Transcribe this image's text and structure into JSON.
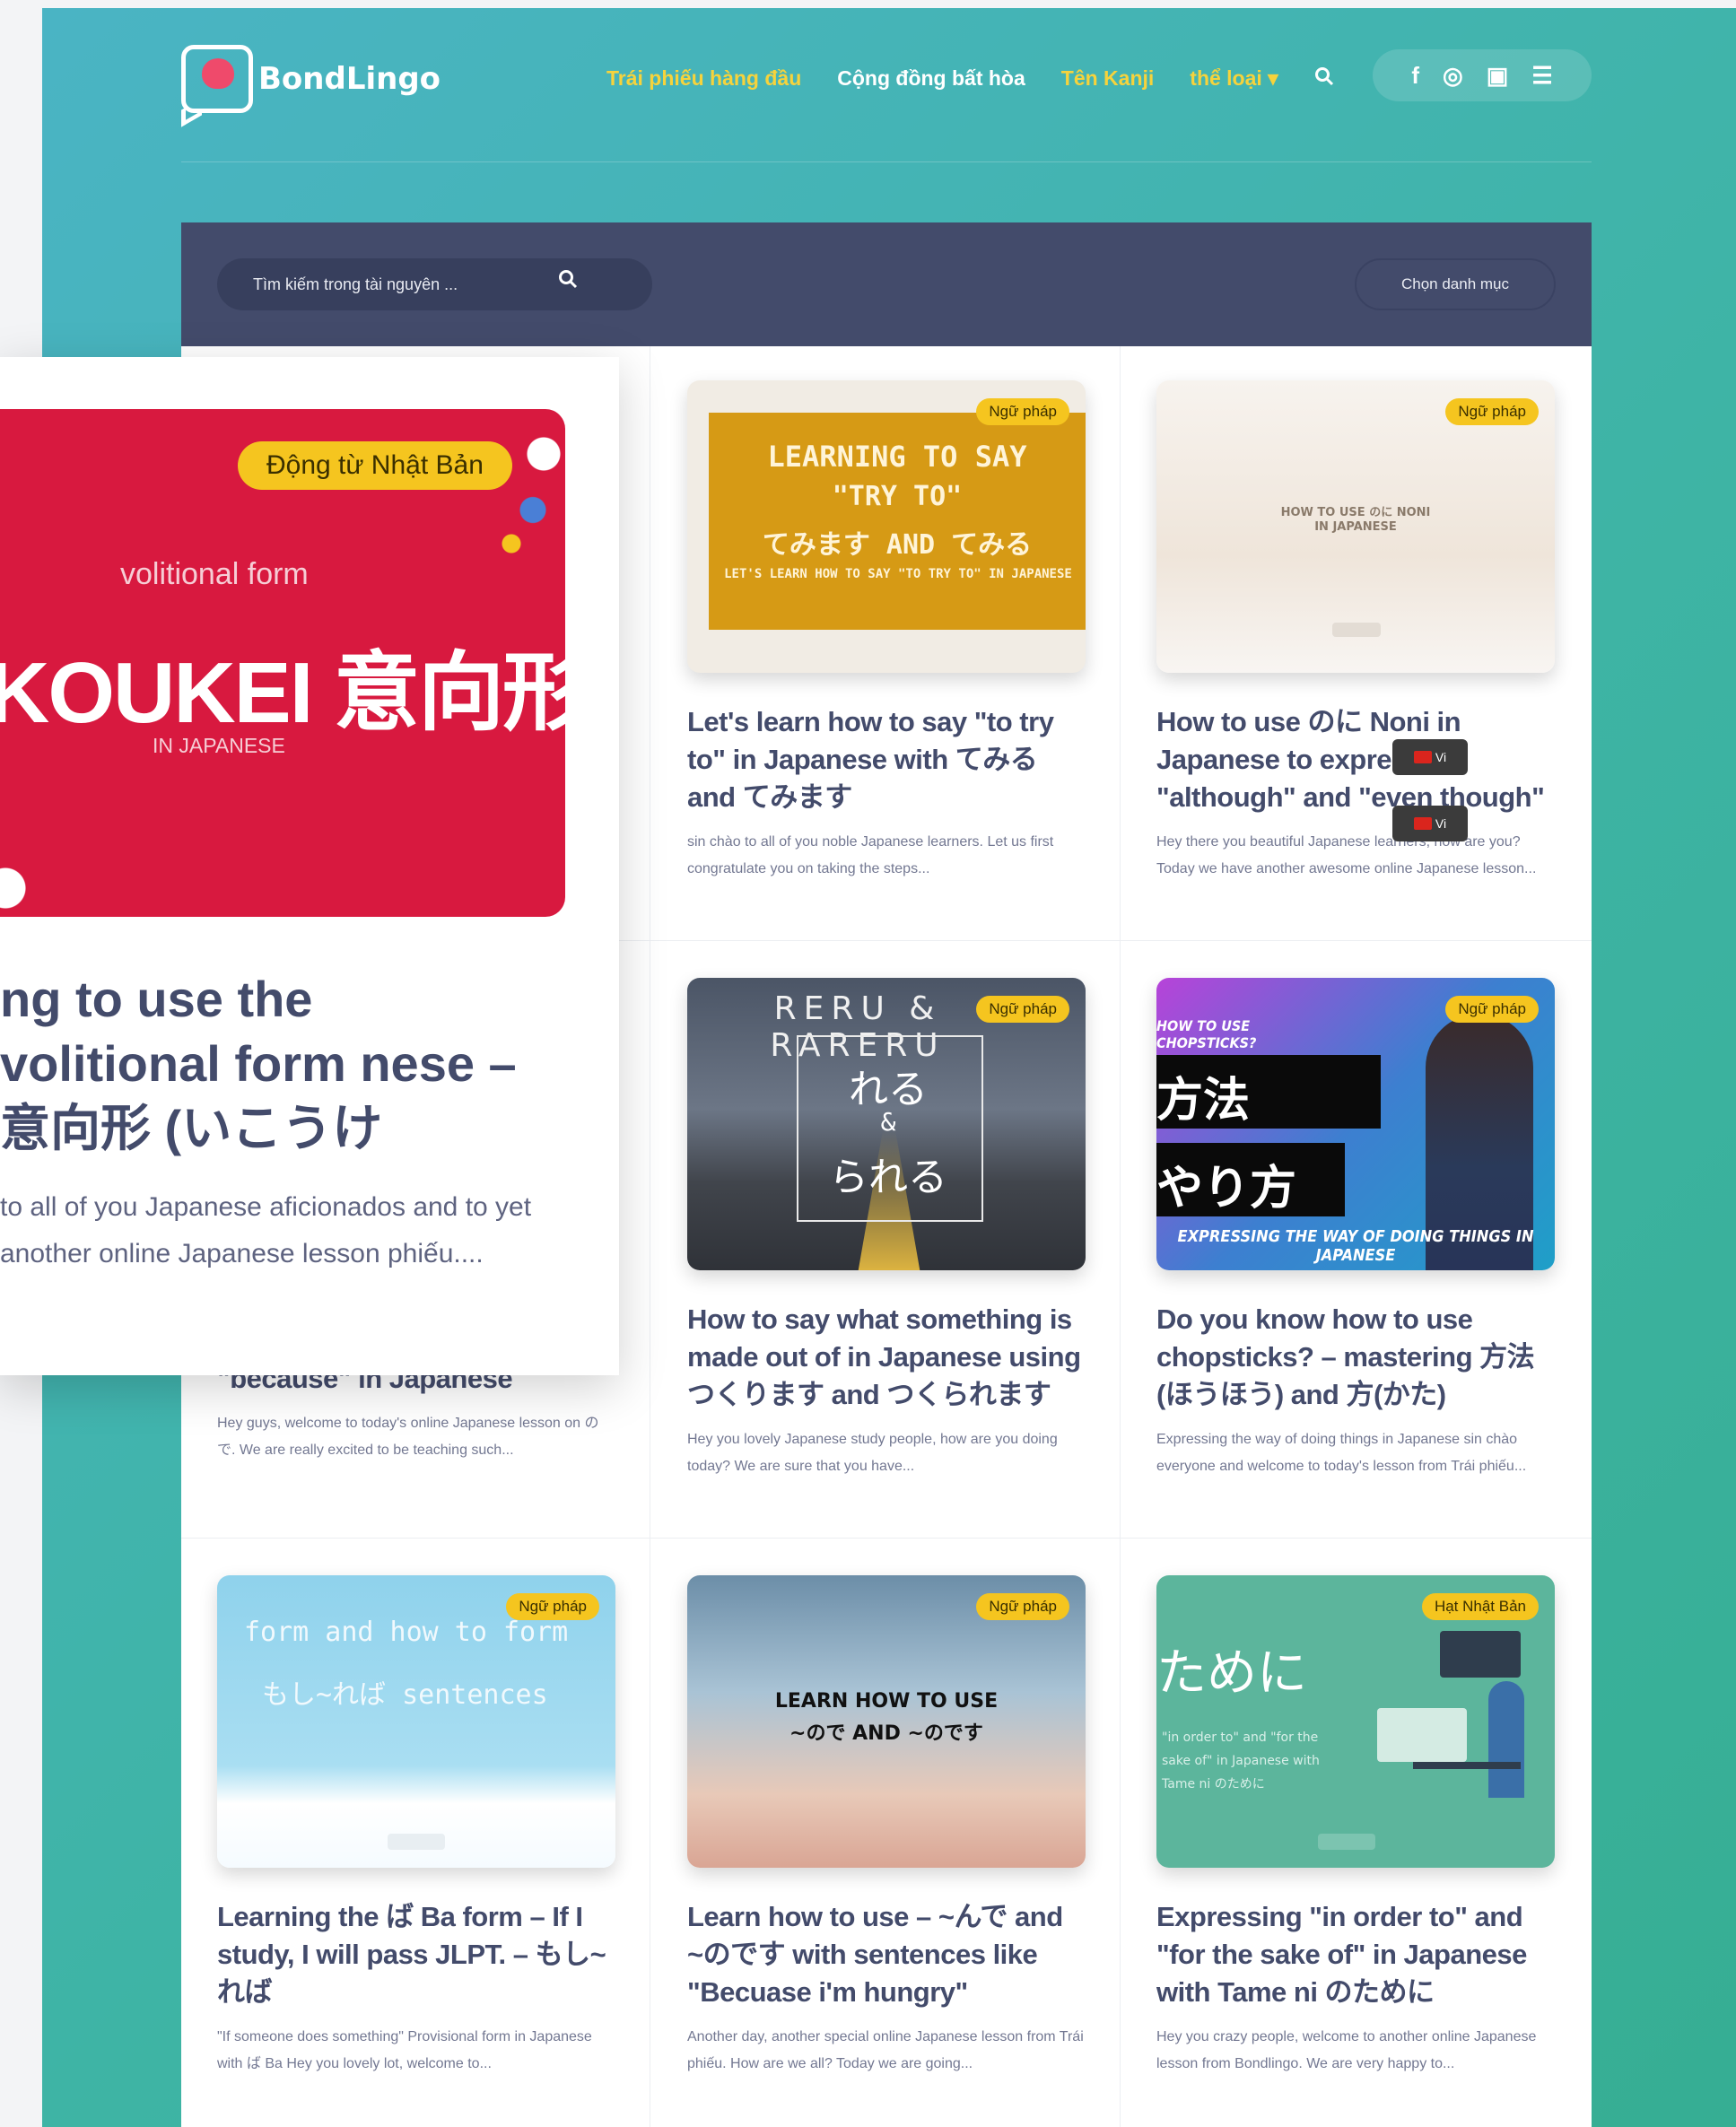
{
  "header": {
    "logo_text": "BondLingo",
    "nav": [
      {
        "label": "Trái phiếu hàng đầu",
        "style": "y"
      },
      {
        "label": "Cộng đồng bất hòa",
        "style": "w"
      },
      {
        "label": "Tên Kanji",
        "style": "y"
      },
      {
        "label": "thể loại ▾",
        "style": "y"
      }
    ],
    "search_icon": "search-icon",
    "social": [
      "f",
      "◎",
      "▣",
      "☰"
    ]
  },
  "toolbar": {
    "search_placeholder": "Tìm kiếm trong tài nguyên ...",
    "category_select": "Chọn danh mục"
  },
  "featured": {
    "badge": "Động từ Nhật Bản",
    "thumb_sub": "volitional form",
    "thumb_big": "KOUKEI 意向形",
    "thumb_in": "IN JAPANESE",
    "title": "ng to use the volitional form nese – 意向形 (いこうけ",
    "excerpt": "to all of you Japanese aficionados and to yet another online Japanese lesson phiếu...."
  },
  "hidden_card": {
    "title": "\"because\" in Japanese",
    "excerpt": "Hey guys, welcome to today's online Japanese lesson on ので. We are really excited to be teaching such..."
  },
  "cards": [
    {
      "badge": "Ngữ pháp",
      "thumb_lines": [
        "LEARNING TO SAY",
        "\"TRY TO\"",
        "てみます AND てみる",
        "LET'S LEARN HOW TO SAY \"TO TRY TO\" IN JAPANESE"
      ],
      "title": "Let's learn how to say \"to try to\" in Japanese with てみる and てみます",
      "excerpt": "sin chào to all of you noble Japanese learners. Let us first congratulate you on taking the steps..."
    },
    {
      "badge": "Ngữ pháp",
      "thumb_lines": [
        "HOW TO USE のに NONI",
        "IN JAPANESE"
      ],
      "title": "How to use のに Noni in Japanese to express \"although\" and \"even though\"",
      "excerpt": "Hey there you beautiful Japanese learners, how are you? Today we have another awesome online Japanese lesson..."
    },
    {
      "badge": "Ngữ pháp",
      "thumb_lines": [
        "RERU & RARERU",
        "れる",
        "&",
        "られる"
      ],
      "title": "How to say what something is made out of in Japanese using つくります and つくられます",
      "excerpt": "Hey you lovely Japanese study people, how are you doing today? We are sure that you have..."
    },
    {
      "badge": "Ngữ pháp",
      "thumb_lines": [
        "HOW TO USE CHOPSTICKS?",
        "方法",
        "やり方",
        "EXPRESSING THE WAY OF DOING THINGS IN JAPANESE"
      ],
      "title": "Do you know how to use chopsticks? – mastering 方法(ほうほう) and 方(かた)",
      "excerpt": "Expressing the way of doing things in Japanese sin chào everyone and welcome to today's lesson from Trái phiếu..."
    },
    {
      "badge": "Ngữ pháp",
      "thumb_lines": [
        "form and how to form",
        "もし~れば sentences"
      ],
      "title": "Learning the ば Ba form – If I study, I will pass JLPT. – もし~れば",
      "excerpt": "\"If someone does something\" Provisional form in Japanese with ば Ba  Hey you lovely lot, welcome to..."
    },
    {
      "badge": "Ngữ pháp",
      "thumb_lines": [
        "LEARN HOW TO USE",
        "~ので AND ~のです"
      ],
      "title": "Learn how to use – ~んで and ~のです with sentences like \"Becuase i'm hungry\"",
      "excerpt": "Another day, another special online Japanese lesson from Trái phiếu. How are we all? Today we are going..."
    },
    {
      "badge": "Hạt Nhật Bản",
      "thumb_lines": [
        "ために",
        "\"in order to\" and \"for the sake of\" in Japanese with Tame ni のために"
      ],
      "title": "Expressing \"in order to\" and \"for the sake of\" in Japanese with Tame ni のために",
      "excerpt": "Hey you crazy people, welcome to another online Japanese lesson from Bondlingo. We are very happy to..."
    }
  ],
  "overlay_chip": "Vi"
}
